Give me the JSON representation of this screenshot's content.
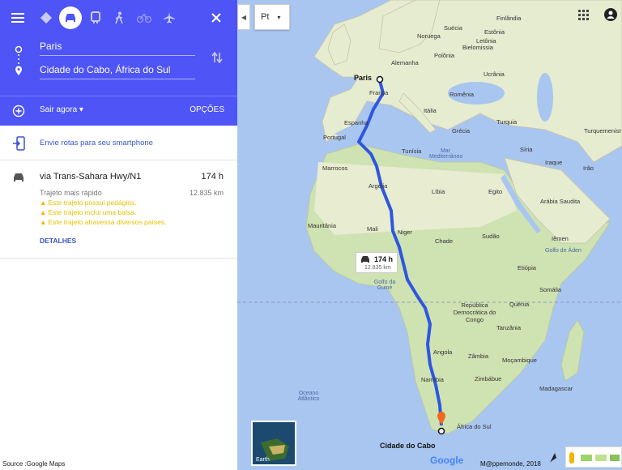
{
  "header": {
    "origin": "Paris",
    "destination": "Cidade do Cabo, África do Sul",
    "leave_now": "Sair agora",
    "options": "OPÇÕES"
  },
  "send_to_phone": "Envie rotas para seu smartphone",
  "route": {
    "title": "via Trans-Sahara Hwy/N1",
    "time": "174 h",
    "subtitle": "Trajeto mais rápido",
    "distance": "12.835 km",
    "warnings": [
      "Este trajeto possui pedágios.",
      "Este trajeto inclui uma balsa.",
      "Este trajeto atravessa diversos países."
    ],
    "details": "DETALHES"
  },
  "source": "Source :Google Maps",
  "map": {
    "language": "Pt",
    "badge_time": "174 h",
    "badge_distance": "12.835 km",
    "origin_label": "Paris",
    "destination_label": "Cidade do Cabo",
    "earth_label": "Earth",
    "logo": "Google",
    "credit": "M@ppemonde, 2018",
    "labels": {
      "finlandia": "Finlândia",
      "suecia": "Suécia",
      "noruega": "Noruega",
      "estonia": "Estônia",
      "letonia": "Letônia",
      "belomissia": "Bielomissia",
      "polonia": "Polônia",
      "alemanha": "Alemanha",
      "ucrania": "Ucrânia",
      "franca": "França",
      "romenia": "Romênia",
      "italia": "Itália",
      "espanha": "Espanha",
      "portugal": "Portugal",
      "grecia": "Grécia",
      "turquia": "Turquia",
      "turquemenistao": "Turquemenist",
      "marrocos": "Marrocos",
      "tunisia": "Tunísia",
      "siria": "Síria",
      "iraque": "Iraque",
      "ira": "Irão",
      "argelia": "Argélia",
      "libia": "Líbia",
      "egito": "Egito",
      "arabia": "Arábia Saudita",
      "mauritania": "Mauritânia",
      "mali": "Mali",
      "niger": "Niger",
      "chade": "Chade",
      "sudao": "Sudão",
      "iemen": "Iêmen",
      "etiopia": "Etiópia",
      "somalia": "Somália",
      "quenia": "Quênia",
      "rdc": "República Democrática do Congo",
      "tanzania": "Tanzânia",
      "angola": "Angola",
      "zambia": "Zâmbia",
      "mocambique": "Moçambique",
      "zimbabue": "Zimbábue",
      "namibia": "Namíbia",
      "madagascar": "Madagascar",
      "africa_sul": "África do Sul",
      "mar_mediterraneo": "Mar Mediterrâneo",
      "golfo_guine": "Golfo da Guiné",
      "golfo_aden": "Golfo de Áden",
      "oceano_atlantico": "Oceano Atlântico"
    }
  }
}
